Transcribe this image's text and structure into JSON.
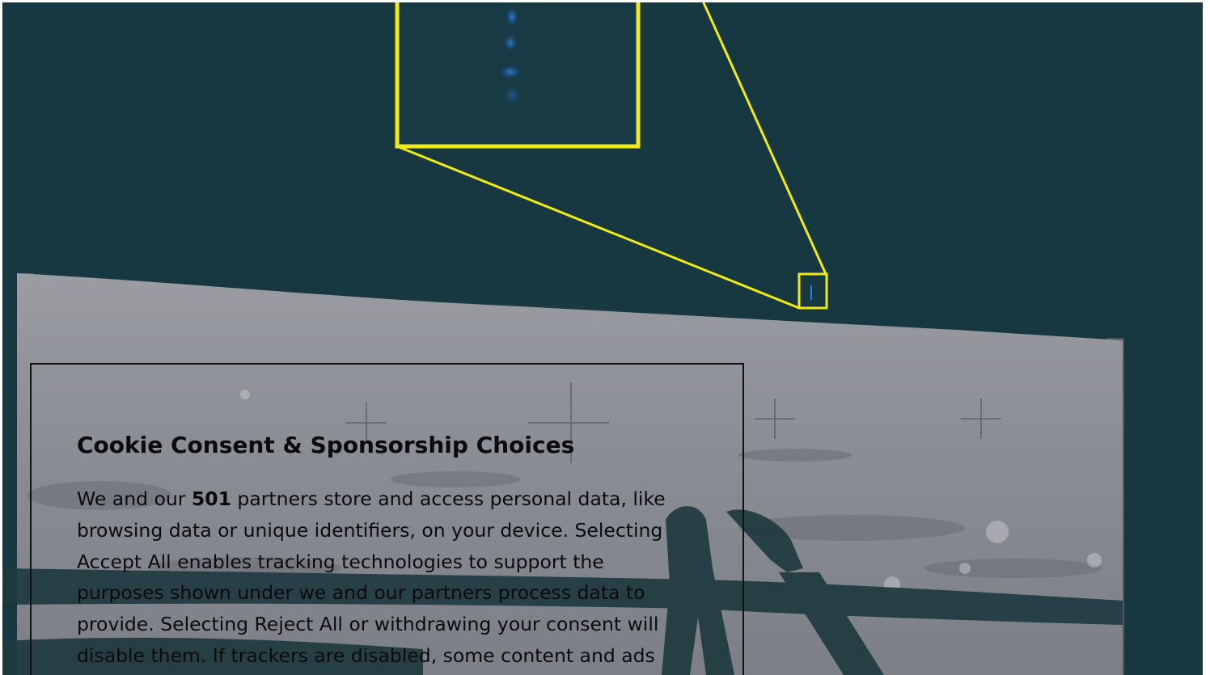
{
  "photo": {
    "colors": {
      "sky": "#173840",
      "surface": "#8f9298",
      "callout": "#f2ea16",
      "shadow": "#1f3a40"
    }
  },
  "consent": {
    "title": "Cookie Consent & Sponsorship Choices",
    "body_prefix": "We and our ",
    "partner_count": "501",
    "body_suffix": " partners store and access personal data, like browsing data or unique identifiers, on your device. Selecting Accept All enables tracking technologies to support the purposes shown under we and our partners process data to provide. Selecting Reject All or withdrawing your consent will disable them. If trackers are disabled, some content and ads"
  }
}
